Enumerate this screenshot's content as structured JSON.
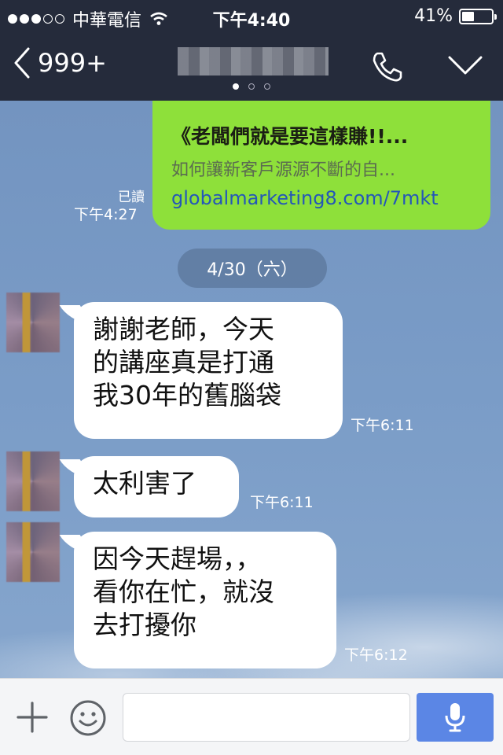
{
  "status_bar": {
    "carrier": "中華電信",
    "time": "下午4:40",
    "battery_percent": "41%",
    "battery_level": 0.41,
    "signal_bars_filled": 3,
    "signal_bars_total": 5,
    "wifi_icon": "wifi-icon"
  },
  "nav": {
    "back_label": "999+",
    "contact_name": "",
    "page_indicator": {
      "count": 3,
      "active": 0
    },
    "call_icon": "phone-icon",
    "menu_icon": "chevron-down-icon",
    "bar_color": "#252b3b"
  },
  "messages": {
    "link_preview": {
      "title": "《老闆們就是要這樣賺!!...",
      "description": "如何讓新客戶源源不斷的自...",
      "url": "globalmarketing8.com/7mkt",
      "read_status": "已讀",
      "time": "下午4:27",
      "bubble_color": "#8ee03a"
    },
    "date_separator": "4/30（六）",
    "incoming": [
      {
        "lines": [
          "謝謝老師，今天",
          "的講座真是打通",
          "我30年的舊腦袋"
        ],
        "time": "下午6:11"
      },
      {
        "lines": [
          "太利害了"
        ],
        "time": "下午6:11"
      },
      {
        "lines": [
          "因今天趕場，，",
          "看你在忙，就沒",
          "去打擾你"
        ],
        "time": "下午6:12"
      }
    ]
  },
  "input_bar": {
    "plus_icon": "plus-icon",
    "sticker_icon": "smiley-icon",
    "text_value": "",
    "voice_icon": "microphone-icon",
    "voice_button_color": "#5b86e5"
  }
}
